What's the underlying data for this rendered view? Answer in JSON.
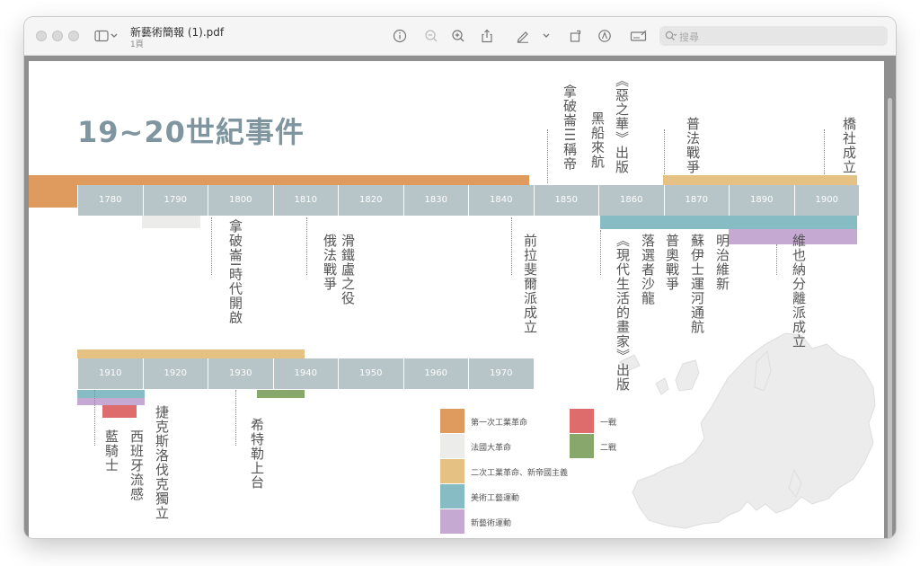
{
  "window": {
    "file_name": "新藝術簡報 (1).pdf",
    "page_count": "1頁",
    "search_placeholder": "搜尋",
    "toolbar_icons": [
      "sidebar-icon",
      "chevron-down-icon",
      "info-icon",
      "zoom-out-icon",
      "zoom-in-icon",
      "share-icon",
      "markup-pen-icon",
      "chevron-down-icon",
      "rotate-icon",
      "markup-circle-icon",
      "form-icon",
      "search-icon"
    ]
  },
  "slide": {
    "title": "19~20世紀事件",
    "axis1_ticks": [
      "1780",
      "1790",
      "1800",
      "1810",
      "1820",
      "1830",
      "1840",
      "1850",
      "1860",
      "1870",
      "1890",
      "1900"
    ],
    "axis2_ticks": [
      "1910",
      "1920",
      "1930",
      "1940",
      "1950",
      "1960",
      "1970"
    ],
    "events_above": [
      "拿破崙III稱帝",
      "黑船來航",
      "《惡之華》出版",
      "普法戰爭",
      "橋社成立"
    ],
    "events_below": [
      "拿破崙I時代開啟",
      "俄法戰爭",
      "滑鐵盧之役",
      "前拉斐爾派成立",
      "《現代生活的畫家》出版",
      "落選者沙龍",
      "普奧戰爭",
      "蘇伊士運河通航",
      "明治維新",
      "維也納分離派成立"
    ],
    "events_row2": [
      "藍騎士",
      "西班牙流感",
      "捷克斯洛伐克獨立",
      "希特勒上台"
    ],
    "legend": [
      {
        "label": "第一次工業革命",
        "color": "#df9a5e"
      },
      {
        "label": "法國大革命",
        "color": "#ececea"
      },
      {
        "label": "二次工業革命、新帝國主義",
        "color": "#e5c283"
      },
      {
        "label": "美術工藝運動",
        "color": "#88bcc4"
      },
      {
        "label": "新藝術運動",
        "color": "#c6a9d2"
      },
      {
        "label": "一戰",
        "color": "#df6c6c"
      },
      {
        "label": "二戰",
        "color": "#87a86a"
      }
    ]
  }
}
